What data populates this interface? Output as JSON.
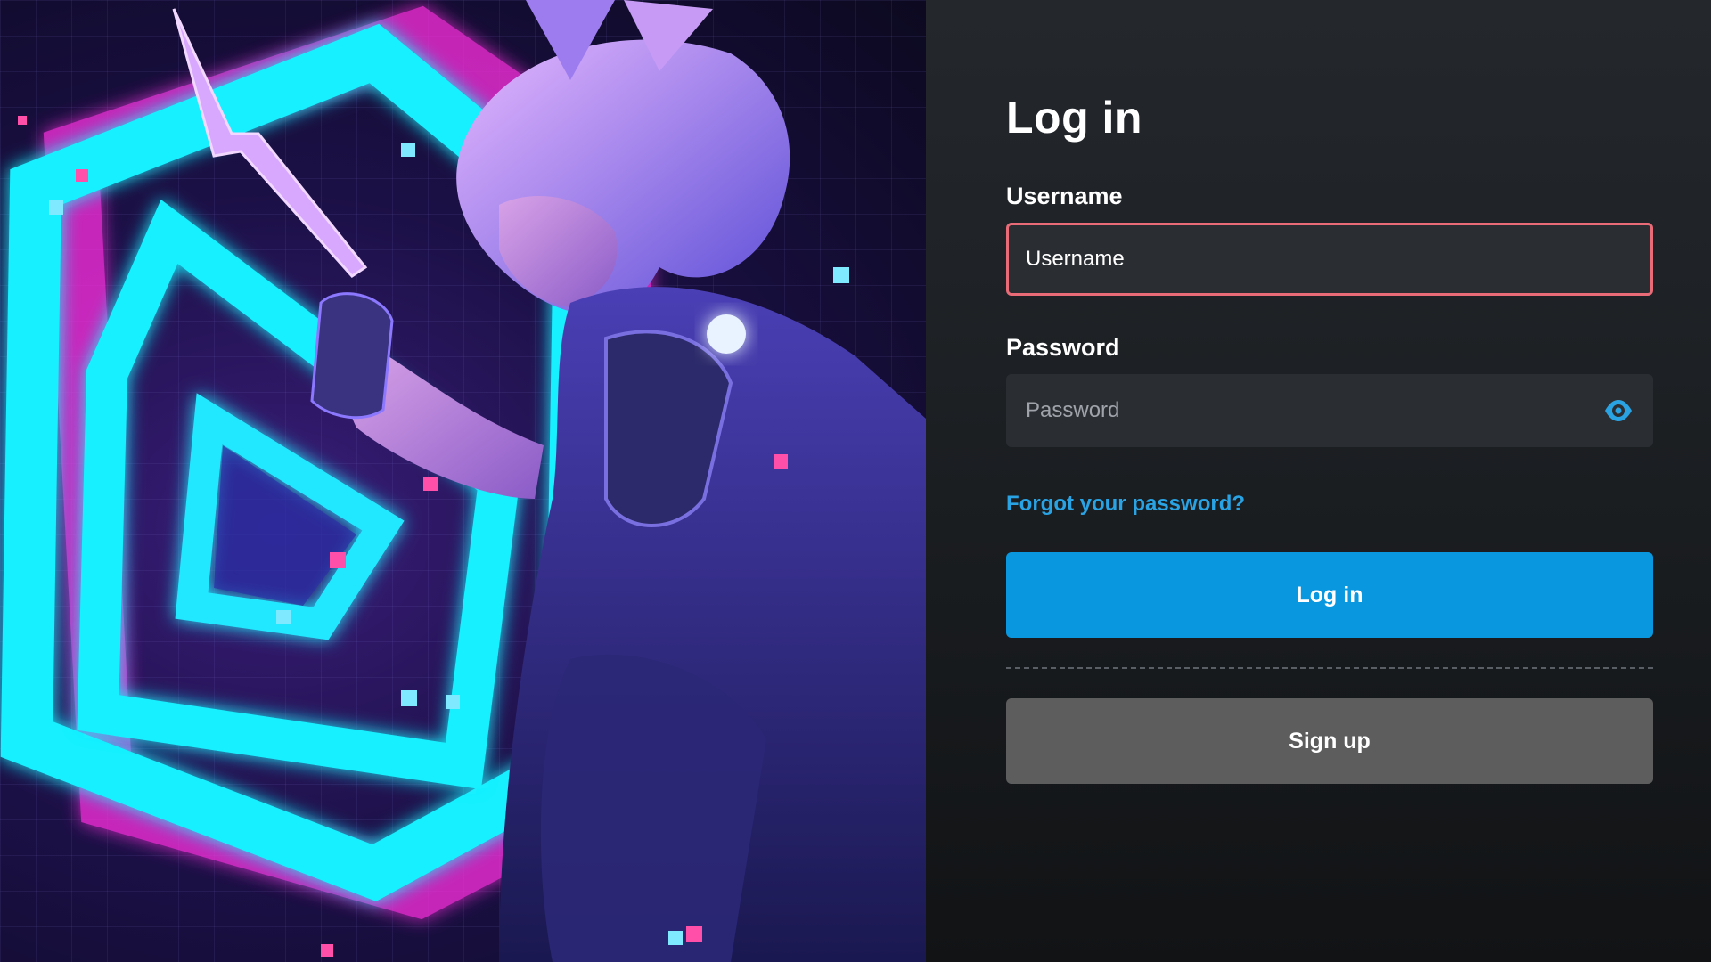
{
  "artwork": {
    "icon": "neon-character-artwork"
  },
  "form": {
    "title": "Log in",
    "username": {
      "label": "Username",
      "placeholder": "Username"
    },
    "password": {
      "label": "Password",
      "placeholder": "Password",
      "toggle_icon": "eye-icon"
    },
    "forgot_link": "Forgot your password?",
    "login_button": "Log in",
    "signup_button": "Sign up"
  },
  "colors": {
    "accent": "#0998e0",
    "link": "#2aa3e4",
    "error_border": "#e96b78",
    "secondary_button": "#5d5d5d",
    "panel_background": "#1e2226",
    "input_background": "#2a2e33"
  }
}
